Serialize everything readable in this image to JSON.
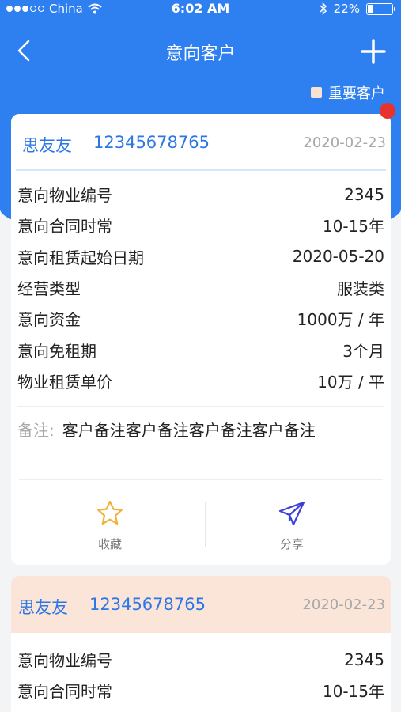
{
  "status_bar": {
    "carrier": "China",
    "time": "6:02 AM",
    "battery": "22%",
    "battery_level": 0.22
  },
  "nav": {
    "title": "意向客户"
  },
  "legend": {
    "label": "重要客户",
    "swatch_color": "#f9e3d4"
  },
  "cards": [
    {
      "name": "思友友",
      "phone": "12345678765",
      "date": "2020-02-23",
      "important": false,
      "rows": [
        {
          "label": "意向物业编号",
          "value": "2345"
        },
        {
          "label": "意向合同时常",
          "value": "10-15年"
        },
        {
          "label": "意向租赁起始日期",
          "value": "2020-05-20"
        },
        {
          "label": "经营类型",
          "value": "服装类"
        },
        {
          "label": "意向资金",
          "value": "1000万 / 年"
        },
        {
          "label": "意向免租期",
          "value": "3个月"
        },
        {
          "label": "物业租赁单价",
          "value": "10万 / 平"
        }
      ],
      "remark_label": "备注:",
      "remark": "客户备注客户备注客户备注客户备注",
      "actions": {
        "favorite": "收藏",
        "share": "分享"
      }
    },
    {
      "name": "思友友",
      "phone": "12345678765",
      "date": "2020-02-23",
      "important": true,
      "rows": [
        {
          "label": "意向物业编号",
          "value": "2345"
        },
        {
          "label": "意向合同时常",
          "value": "10-15年"
        }
      ]
    }
  ],
  "colors": {
    "primary": "#2e7ff0",
    "accent_text": "#2d76e6",
    "important_bg": "#fbe5d8",
    "badge": "#e8322e",
    "star": "#f0b23a",
    "share": "#3a3fd8"
  }
}
